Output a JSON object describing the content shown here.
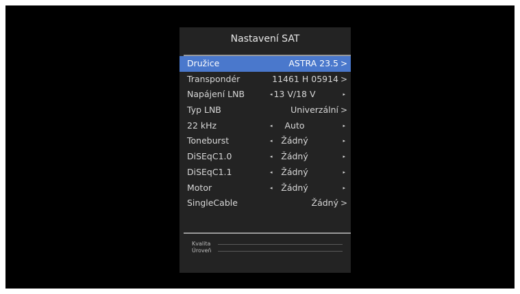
{
  "panel": {
    "title": "Nastavení SAT"
  },
  "rows": [
    {
      "label": "Družice",
      "value": "ASTRA 23.5",
      "arrow": ">"
    },
    {
      "label": "Transpondér",
      "value": "11461 H 05914",
      "arrow": ">"
    },
    {
      "label": "Napájení LNB",
      "value": "13 V/18 V",
      "left": "◂",
      "right": "▸"
    },
    {
      "label": "Typ LNB",
      "value": "Univerzální",
      "arrow": ">"
    },
    {
      "label": "22 kHz",
      "value": "Auto",
      "left": "◂",
      "right": "▸"
    },
    {
      "label": "Toneburst",
      "value": "Žádný",
      "left": "◂",
      "right": "▸"
    },
    {
      "label": "DiSEqC1.0",
      "value": "Žádný",
      "left": "◂",
      "right": "▸"
    },
    {
      "label": "DiSEqC1.1",
      "value": "Žádný",
      "left": "◂",
      "right": "▸"
    },
    {
      "label": "Motor",
      "value": "Žádný",
      "left": "◂",
      "right": "▸"
    },
    {
      "label": "SingleCable",
      "value": "Žádný",
      "arrow": ">"
    }
  ],
  "meters": [
    {
      "label": "Kvalita",
      "level": 0
    },
    {
      "label": "Úroveň",
      "level": 0
    }
  ],
  "colors": {
    "selected_row": "#4a78cc",
    "panel_bg": "#232323",
    "screen_bg": "#000000"
  }
}
